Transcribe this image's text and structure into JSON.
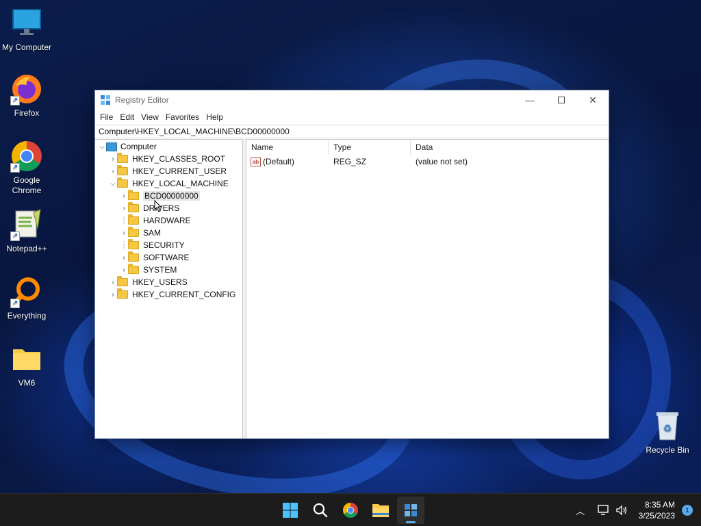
{
  "desktop": {
    "icons": [
      {
        "label": "My Computer"
      },
      {
        "label": "Firefox"
      },
      {
        "label": "Google Chrome"
      },
      {
        "label": "Notepad++"
      },
      {
        "label": "Everything"
      },
      {
        "label": "VM6"
      },
      {
        "label": "Recycle Bin"
      }
    ]
  },
  "window": {
    "title": "Registry Editor",
    "menu": [
      "File",
      "Edit",
      "View",
      "Favorites",
      "Help"
    ],
    "address": "Computer\\HKEY_LOCAL_MACHINE\\BCD00000000",
    "tree": {
      "root": "Computer",
      "hkeys": [
        "HKEY_CLASSES_ROOT",
        "HKEY_CURRENT_USER",
        "HKEY_LOCAL_MACHINE",
        "HKEY_USERS",
        "HKEY_CURRENT_CONFIG"
      ],
      "hklm_children": [
        "BCD00000000",
        "DRIVERS",
        "HARDWARE",
        "SAM",
        "SECURITY",
        "SOFTWARE",
        "SYSTEM"
      ],
      "selected": "BCD00000000"
    },
    "columns": [
      "Name",
      "Type",
      "Data"
    ],
    "values": [
      {
        "name": "(Default)",
        "type": "REG_SZ",
        "data": "(value not set)"
      }
    ]
  },
  "taskbar": {
    "apps": [
      "start-icon",
      "search-icon",
      "chrome-icon",
      "file-explorer-icon",
      "registry-editor-icon"
    ],
    "time": "8:35 AM",
    "date": "3/25/2023",
    "notification_count": "1"
  },
  "colors": {
    "accent": "#60aee8",
    "folder": "#f5c742",
    "taskbar": "#1c1c1c"
  }
}
